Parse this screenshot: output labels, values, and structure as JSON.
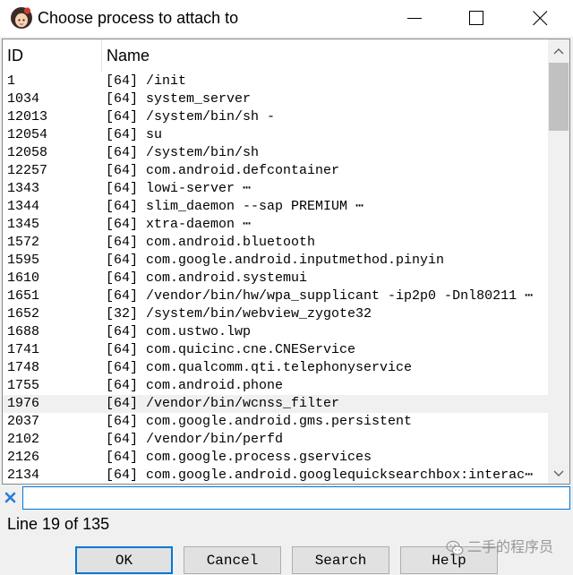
{
  "window": {
    "title": "Choose process to attach to",
    "icons": {
      "app": "app-icon",
      "minimize": "minimize-icon",
      "maximize": "maximize-icon",
      "close": "close-icon"
    }
  },
  "table": {
    "columns": {
      "id": "ID",
      "name": "Name"
    },
    "rows": [
      {
        "id": "1",
        "name": "[64] /init"
      },
      {
        "id": "1034",
        "name": "[64] system_server"
      },
      {
        "id": "12013",
        "name": "[64] /system/bin/sh -"
      },
      {
        "id": "12054",
        "name": "[64] su"
      },
      {
        "id": "12058",
        "name": "[64] /system/bin/sh"
      },
      {
        "id": "12257",
        "name": "[64] com.android.defcontainer"
      },
      {
        "id": "1343",
        "name": "[64] lowi-server ⋯"
      },
      {
        "id": "1344",
        "name": "[64] slim_daemon --sap PREMIUM ⋯"
      },
      {
        "id": "1345",
        "name": "[64] xtra-daemon ⋯"
      },
      {
        "id": "1572",
        "name": "[64] com.android.bluetooth"
      },
      {
        "id": "1595",
        "name": "[64] com.google.android.inputmethod.pinyin"
      },
      {
        "id": "1610",
        "name": "[64] com.android.systemui"
      },
      {
        "id": "1651",
        "name": "[64] /vendor/bin/hw/wpa_supplicant -ip2p0 -Dnl80211 ⋯"
      },
      {
        "id": "1652",
        "name": "[32] /system/bin/webview_zygote32"
      },
      {
        "id": "1688",
        "name": "[64] com.ustwo.lwp"
      },
      {
        "id": "1741",
        "name": "[64] com.quicinc.cne.CNEService"
      },
      {
        "id": "1748",
        "name": "[64] com.qualcomm.qti.telephonyservice"
      },
      {
        "id": "1755",
        "name": "[64] com.android.phone"
      },
      {
        "id": "1976",
        "name": "[64] /vendor/bin/wcnss_filter",
        "selected": true
      },
      {
        "id": "2037",
        "name": "[64] com.google.android.gms.persistent"
      },
      {
        "id": "2102",
        "name": "[64] /vendor/bin/perfd"
      },
      {
        "id": "2126",
        "name": "[64] com.google.process.gservices"
      },
      {
        "id": "2134",
        "name": "[64] com.google.android.googlequicksearchbox:interac⋯"
      }
    ]
  },
  "scrollbar": {
    "up_icon": "chevron-up-icon",
    "down_icon": "chevron-down-icon",
    "top_fraction": 0,
    "visible_fraction": 0.17
  },
  "search": {
    "clear_icon": "clear-icon"
  },
  "status": {
    "text": "Line 19 of 135"
  },
  "buttons": {
    "ok": "OK",
    "cancel": "Cancel",
    "search": "Search",
    "help": "Help"
  },
  "watermark": {
    "icon": "wechat-icon",
    "text": "二手的程序员"
  },
  "colors": {
    "accent": "#0078d7",
    "selected_row": "#f0f0f0",
    "clear_icon": "#2b7bd8",
    "scroll_thumb": "#c1c1c1"
  }
}
